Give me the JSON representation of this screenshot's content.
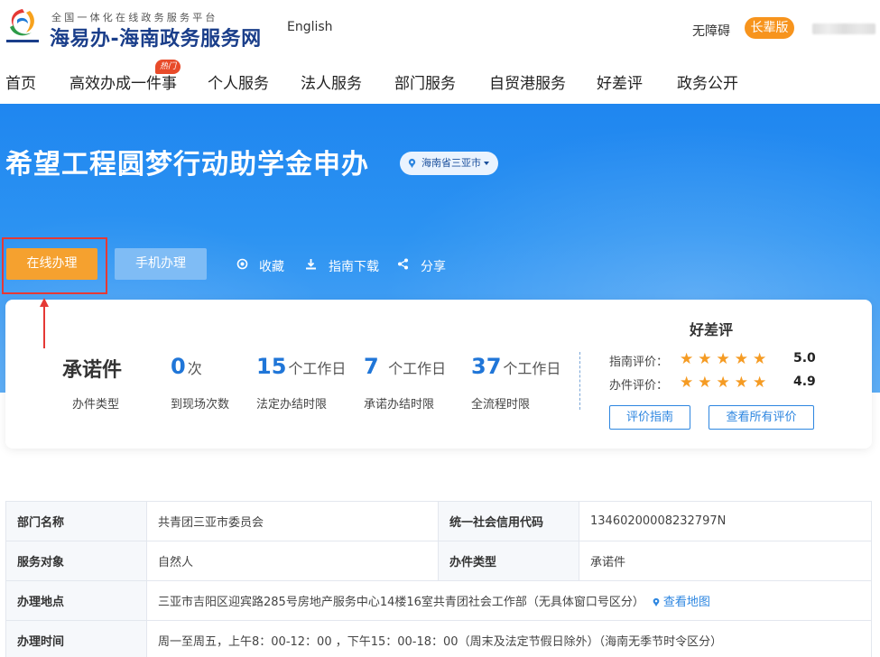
{
  "header": {
    "brand_subtitle": "全国一体化在线政务服务平台",
    "brand_title": "海易办-海南政务服务网",
    "logo_caption": "海南政务服务网",
    "lang_link": "English",
    "accessibility": "无障碍",
    "elder_mode": "长辈版",
    "hot_badge": "热门"
  },
  "nav": {
    "items": [
      "首页",
      "高效办成一件事",
      "个人服务",
      "法人服务",
      "部门服务",
      "自贸港服务",
      "好差评",
      "政务公开"
    ]
  },
  "banner": {
    "title": "希望工程圆梦行动助学金申办",
    "region": "海南省三亚市",
    "online_button": "在线办理",
    "mobile_button": "手机办理",
    "favorite": "收藏",
    "guide_download": "指南下载",
    "share": "分享"
  },
  "stats": {
    "type_value": "承诺件",
    "type_label": "办件类型",
    "visits_value": "0",
    "visits_unit": "次",
    "visits_label": "到现场次数",
    "legal_value": "15",
    "legal_unit": "个工作日",
    "legal_label": "法定办结时限",
    "promise_value": "7",
    "promise_unit": "个工作日",
    "promise_label": "承诺办结时限",
    "total_value": "37",
    "total_unit": "个工作日",
    "total_label": "全流程时限"
  },
  "rating": {
    "title": "好差评",
    "guide_label": "指南评价：",
    "guide_stars": "★★★★★",
    "guide_score": "5.0",
    "service_label": "办件评价：",
    "service_stars": "★★★★★",
    "service_score": "4.9",
    "rate_guide_button": "评价指南",
    "view_all_button": "查看所有评价"
  },
  "info": {
    "dept_label": "部门名称",
    "dept_value": "共青团三亚市委员会",
    "credit_label": "统一社会信用代码",
    "credit_value": "1346020000823279‌7N",
    "target_label": "服务对象",
    "target_value": "自然人",
    "type_label": "办件类型",
    "type_value": "承诺件",
    "location_label": "办理地点",
    "location_value": "三亚市吉阳区迎宾路285号房地产服务中心14楼16室共青团社会工作部（无具体窗口号区分）",
    "map_link": "查看地图",
    "time_label": "办理时间",
    "time_value": "周一至周五，上午8：00-12：00 ，下午15：00-18：00（周末及法定节假日除外）（海南无季节时令区分）"
  },
  "colors": {
    "primary_blue": "#2076d8",
    "orange": "#f5a12f",
    "star": "#f59b23",
    "highlight_red": "#e53935"
  }
}
